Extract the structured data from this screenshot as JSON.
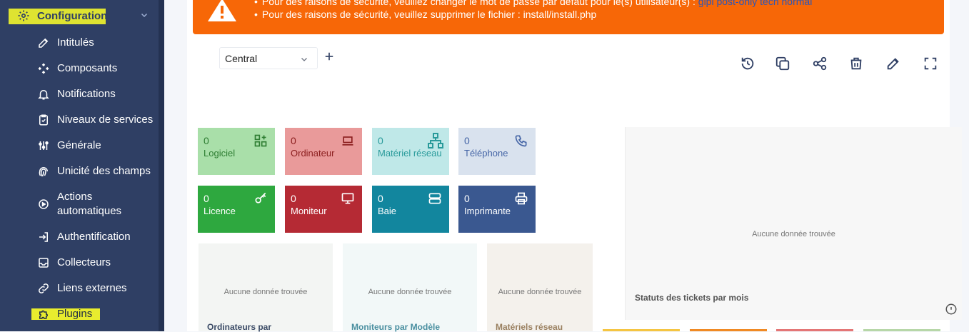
{
  "sidebar": {
    "header": {
      "label": "Configuration",
      "icon": "gear-icon"
    },
    "items": [
      {
        "label": "Intitulés",
        "icon": "edit-icon"
      },
      {
        "label": "Composants",
        "icon": "components-icon"
      },
      {
        "label": "Notifications",
        "icon": "bell-icon"
      },
      {
        "label": "Niveaux de services",
        "icon": "clipboard-icon"
      },
      {
        "label": "Générale",
        "icon": "adjustments-icon"
      },
      {
        "label": "Unicité des champs",
        "icon": "fingerprint-icon"
      },
      {
        "label": "Actions automatiques",
        "label_line1": "Actions",
        "label_line2": "automatiques",
        "icon": "automation-icon"
      },
      {
        "label": "Authentification",
        "icon": "login-icon"
      },
      {
        "label": "Collecteurs",
        "icon": "inbox-icon"
      },
      {
        "label": "Liens externes",
        "icon": "link-icon"
      },
      {
        "label": "Plugins",
        "icon": "puzzle-icon"
      }
    ]
  },
  "alert": {
    "line1_text": "Pour des raisons de sécurité, veuillez changer le mot de passe par défaut pour le(s) utilisateur(s) :",
    "line1_link": "glpi post-only tech normal",
    "line2_text": "Pour des raisons de sécurité, veuillez supprimer le fichier : install/install.php"
  },
  "dashboard": {
    "selected": "Central",
    "add_label": "+"
  },
  "toolbar": [
    "history-icon",
    "clone-icon",
    "share-icon",
    "delete-icon",
    "edit-icon",
    "fullscreen-icon"
  ],
  "tiles": [
    {
      "count": "0",
      "label": "Logiciel",
      "bg": "#a9dfa9",
      "fg": "#2e7d32",
      "icon": "apps-icon"
    },
    {
      "count": "0",
      "label": "Ordinateur",
      "bg": "#e99a9a",
      "fg": "#8b1e1e",
      "icon": "laptop-icon"
    },
    {
      "count": "0",
      "label": "Matériel réseau",
      "bg": "#bfe8e8",
      "fg": "#2a9b9b",
      "icon": "network-icon"
    },
    {
      "count": "0",
      "label": "Téléphone",
      "bg": "#d9e2ee",
      "fg": "#4565a6",
      "icon": "phone-icon"
    },
    {
      "count": "0",
      "label": "Licence",
      "bg": "#2ea83f",
      "fg": "#ffffff",
      "icon": "key-icon"
    },
    {
      "count": "0",
      "label": "Moniteur",
      "bg": "#b52a34",
      "fg": "#ffffff",
      "icon": "monitor-icon"
    },
    {
      "count": "0",
      "label": "Baie",
      "bg": "#12869e",
      "fg": "#ffffff",
      "icon": "server-icon"
    },
    {
      "count": "0",
      "label": "Imprimante",
      "bg": "#3a5890",
      "fg": "#ffffff",
      "icon": "printer-icon"
    }
  ],
  "cards": [
    {
      "empty": "Aucune donnée trouvée",
      "title": "Ordinateurs par",
      "bg": "#f3f5f3",
      "title_color": "#3b4b66"
    },
    {
      "empty": "Aucune donnée trouvée",
      "title": "Moniteurs par Modèle",
      "bg": "#f2f8f8",
      "title_color": "#4a8fa0"
    },
    {
      "empty": "Aucune donnée trouvée",
      "title": "Matériels réseau",
      "bg": "#f4f1ec",
      "title_color": "#9a8060"
    }
  ],
  "big_card": {
    "empty": "Aucune donnée trouvée",
    "title": "Statuts des tickets par mois",
    "icon": "info-circle-icon"
  },
  "colors": {
    "sidebar_bg": "#2f3f64",
    "highlight": "#e8ec2e",
    "alert_bg": "#f76707",
    "strip_colors": [
      "#f5c542",
      "#f08a24",
      "#e47676",
      "#b7d7a8"
    ]
  }
}
